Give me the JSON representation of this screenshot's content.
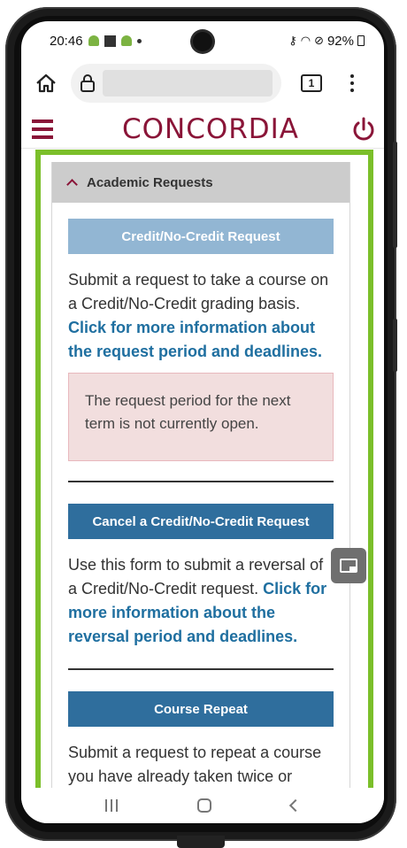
{
  "status_bar": {
    "time": "20:46",
    "battery": "92%"
  },
  "browser": {
    "url": "",
    "tab_count": "1"
  },
  "site": {
    "logo": "CONCORDIA"
  },
  "panel": {
    "title": "Academic Requests"
  },
  "sections": {
    "credit": {
      "button": "Credit/No-Credit Request",
      "desc": "Submit a request to take a course on a Credit/No-Credit grading basis.",
      "link": "Click for more information about the request period and deadlines.",
      "notice": "The request period for the next term is not currently open."
    },
    "cancel": {
      "button": "Cancel a Credit/No-Credit Request",
      "desc": "Use this form to submit a reversal of a Credit/No-Credit request.",
      "link": "Click for more information about the reversal period and deadlines."
    },
    "repeat": {
      "button": "Course Repeat",
      "desc": "Submit a request to repeat a course you have already taken twice or"
    }
  },
  "colors": {
    "brand": "#8a1538",
    "highlight_frame": "#7bbf2a",
    "button_primary": "#2f6e9d",
    "button_disabled": "#92b6d3",
    "link": "#1f6fa0",
    "notice_bg": "#f2dede"
  }
}
